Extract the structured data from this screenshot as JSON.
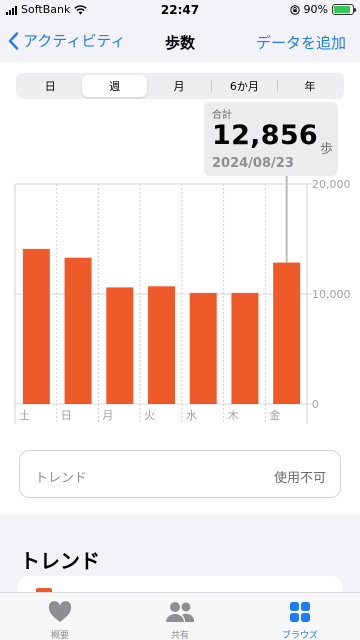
{
  "status": {
    "carrier": "SoftBank",
    "time": "22:47",
    "battery": "90%",
    "battery_level": 0.9
  },
  "nav": {
    "back_label": "アクティビティ",
    "title": "歩数",
    "add_label": "データを追加"
  },
  "segments": [
    {
      "label": "日",
      "active": false
    },
    {
      "label": "週",
      "active": true
    },
    {
      "label": "月",
      "active": false
    },
    {
      "label": "6か月",
      "active": false
    },
    {
      "label": "年",
      "active": false
    }
  ],
  "tooltip": {
    "label": "合計",
    "value": "12,856",
    "unit": "歩",
    "date": "2024/08/23"
  },
  "chart_data": {
    "type": "bar",
    "categories": [
      "土",
      "日",
      "月",
      "火",
      "水",
      "木",
      "金"
    ],
    "values": [
      14100,
      13300,
      10600,
      10700,
      10100,
      10100,
      12856
    ],
    "ylim": [
      0,
      20000
    ],
    "ytick_labels": [
      "20,000",
      "10,000",
      "0"
    ],
    "ytick_values": [
      20000,
      10000,
      0
    ],
    "bar_color": "#ef5a2b",
    "selected_index": 6
  },
  "trend_card": {
    "label": "トレンド",
    "value": "使用不可"
  },
  "section": {
    "heading": "トレンド"
  },
  "tabbar": [
    {
      "label": "概要",
      "icon": "heart-icon",
      "active": false
    },
    {
      "label": "共有",
      "icon": "people-icon",
      "active": false
    },
    {
      "label": "ブラウズ",
      "icon": "grid-icon",
      "active": true
    }
  ],
  "colors": {
    "accent": "#1e7ef7",
    "bar": "#ef5a2b"
  }
}
